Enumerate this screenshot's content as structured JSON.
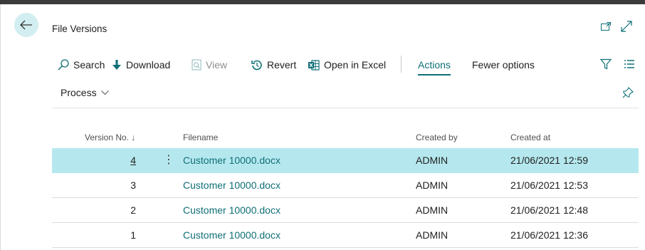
{
  "header": {
    "title": "File Versions"
  },
  "actions": {
    "search": "Search",
    "download": "Download",
    "view": "View",
    "revert": "Revert",
    "open_excel": "Open in Excel",
    "actions_tab": "Actions",
    "fewer_options": "Fewer options"
  },
  "process_menu": {
    "label": "Process"
  },
  "table": {
    "columns": {
      "version": "Version No. ↓",
      "filename": "Filename",
      "created_by": "Created by",
      "created_at": "Created at"
    },
    "rows": [
      {
        "version": "4",
        "filename": "Customer 10000.docx",
        "created_by": "ADMIN",
        "created_at": "21/06/2021 12:59"
      },
      {
        "version": "3",
        "filename": "Customer 10000.docx",
        "created_by": "ADMIN",
        "created_at": "21/06/2021 12:53"
      },
      {
        "version": "2",
        "filename": "Customer 10000.docx",
        "created_by": "ADMIN",
        "created_at": "21/06/2021 12:48"
      },
      {
        "version": "1",
        "filename": "Customer 10000.docx",
        "created_by": "ADMIN",
        "created_at": "21/06/2021 12:36"
      }
    ]
  },
  "icons": [
    "back-arrow-icon",
    "popout-icon",
    "expand-icon",
    "search-icon",
    "download-icon",
    "view-icon",
    "revert-icon",
    "excel-icon",
    "filter-icon",
    "list-view-icon",
    "chevron-down-icon",
    "pin-icon",
    "kebab-icon"
  ],
  "colors": {
    "accent": "#0f6f77",
    "selected_row": "#b5e8ee",
    "back_button": "#d3eef1"
  }
}
